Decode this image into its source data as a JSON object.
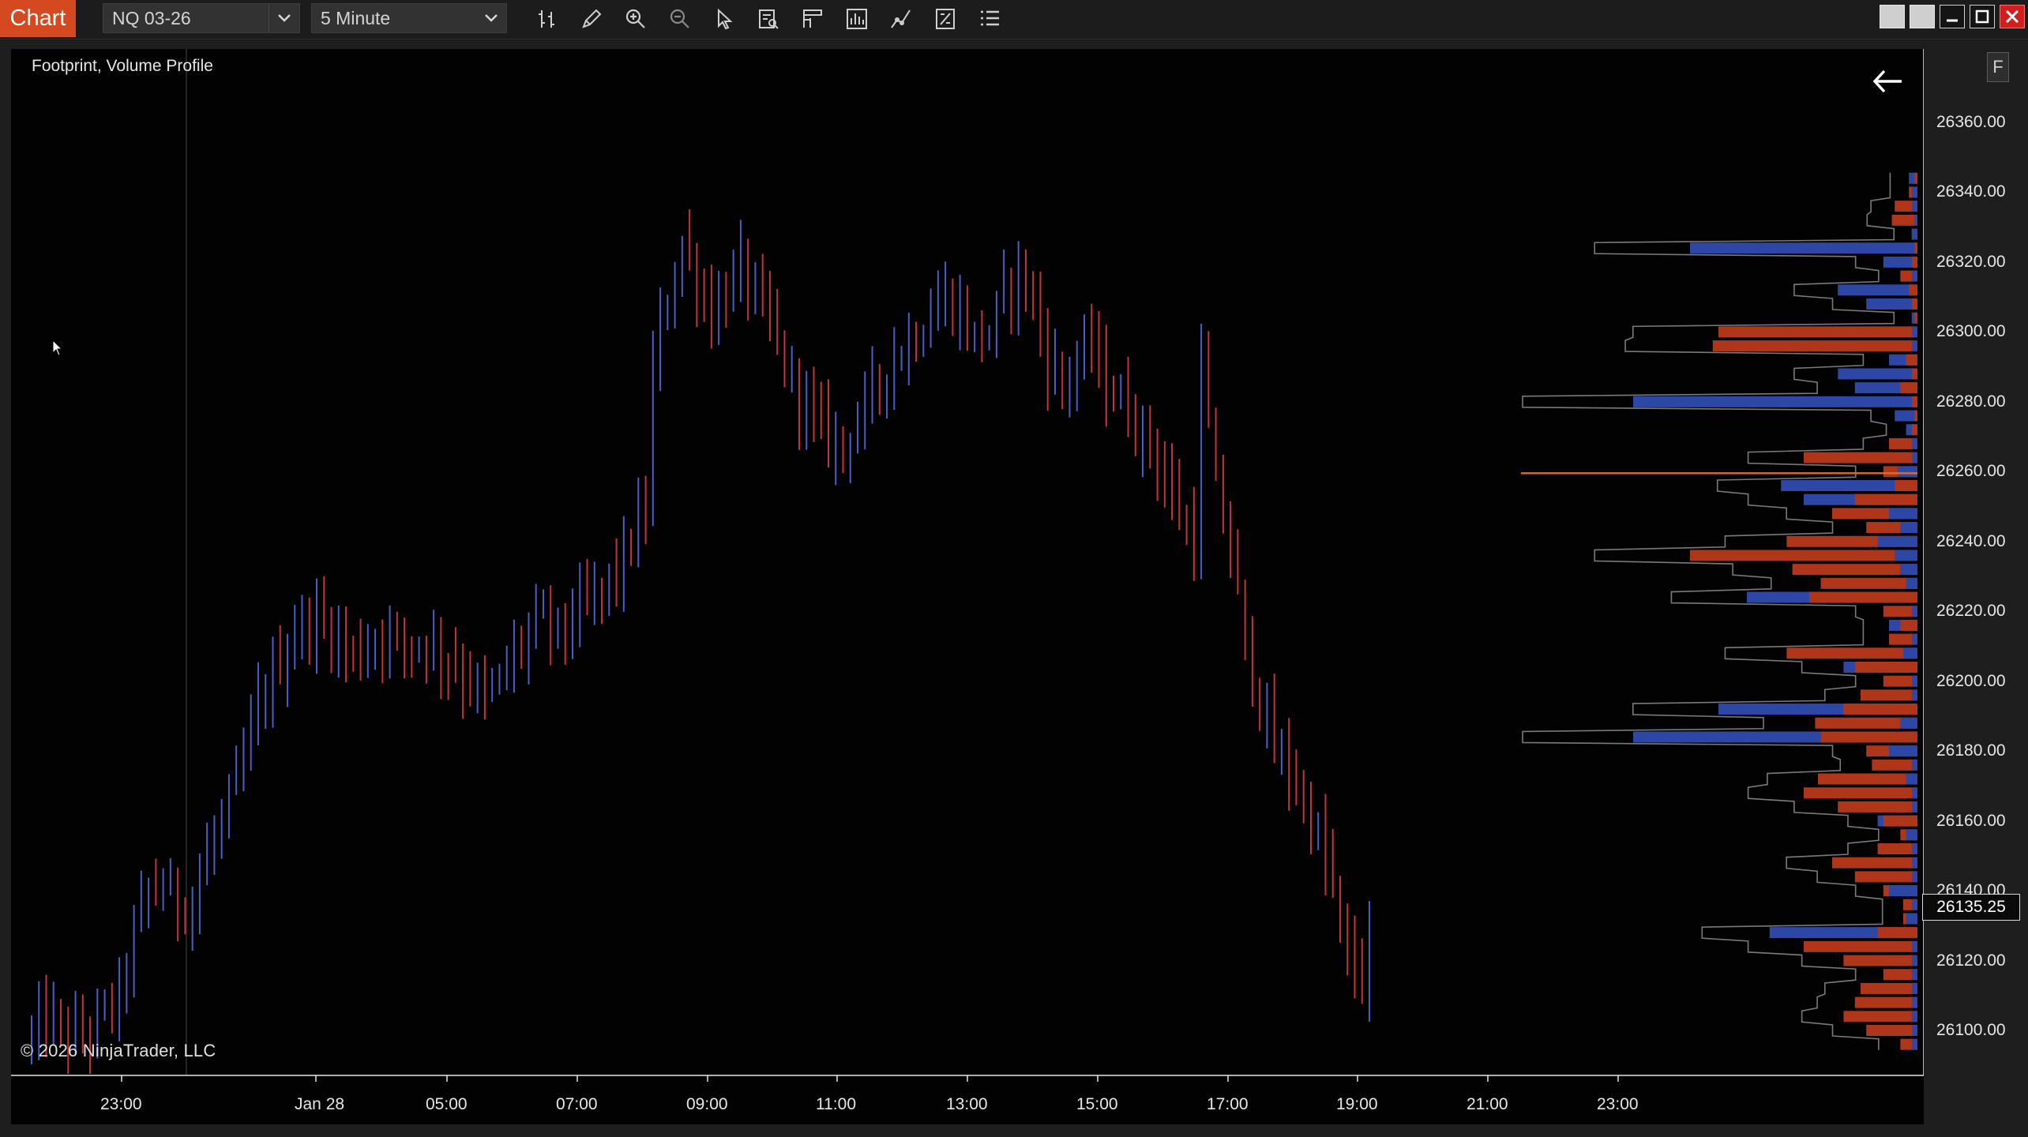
{
  "toolbar": {
    "chart_tab": "Chart",
    "instrument": "NQ 03-26",
    "timeframe": "5 Minute",
    "icons": [
      "bar-type-icon",
      "draw-pencil-icon",
      "zoom-in-icon",
      "zoom-out-icon",
      "pointer-icon",
      "data-box-icon",
      "chart-trader-icon",
      "indicators-icon",
      "strategies-icon",
      "properties-icon",
      "list-icon"
    ]
  },
  "window_controls": [
    "tile-icon",
    "tile-icon",
    "minimize-icon",
    "maximize-icon",
    "close-icon"
  ],
  "chart": {
    "label": "Footprint, Volume Profile",
    "copyright": "© 2026 NinjaTrader, LLC",
    "panel_button": "F",
    "last_price": "26135.25"
  },
  "chart_data": {
    "type": "ohlc-bars",
    "instrument": "NQ 03-26",
    "interval": "5 Minute",
    "price_axis": {
      "ticks": [
        "26360.00",
        "26340.00",
        "26320.00",
        "26300.00",
        "26280.00",
        "26260.00",
        "26240.00",
        "26220.00",
        "26200.00",
        "26180.00",
        "26160.00",
        "26140.00",
        "26120.00",
        "26100.00"
      ],
      "ylim": [
        26088,
        26376
      ]
    },
    "time_axis": {
      "ticks": [
        "23:00",
        "Jan 28",
        "05:00",
        "07:00",
        "09:00",
        "11:00",
        "13:00",
        "15:00",
        "17:00",
        "19:00",
        "21:00",
        "23:00"
      ]
    },
    "colors": {
      "up": "#4a5ec8",
      "down": "#c8323c",
      "profile_ask": "#b0361a",
      "profile_bid": "#2d47a6",
      "poc": "#d7702a"
    },
    "price_path": [
      [
        0,
        26098
      ],
      [
        2,
        26104
      ],
      [
        4,
        26100
      ],
      [
        6,
        26098
      ],
      [
        8,
        26100
      ],
      [
        10,
        26105
      ],
      [
        12,
        26110
      ],
      [
        14,
        26128
      ],
      [
        16,
        26140
      ],
      [
        18,
        26142
      ],
      [
        20,
        26136
      ],
      [
        22,
        26138
      ],
      [
        24,
        26150
      ],
      [
        26,
        26160
      ],
      [
        28,
        26170
      ],
      [
        30,
        26185
      ],
      [
        32,
        26198
      ],
      [
        34,
        26206
      ],
      [
        36,
        26214
      ],
      [
        38,
        26218
      ],
      [
        40,
        26216
      ],
      [
        42,
        26212
      ],
      [
        44,
        26208
      ],
      [
        46,
        26210
      ],
      [
        48,
        26214
      ],
      [
        50,
        26212
      ],
      [
        52,
        26210
      ],
      [
        54,
        26212
      ],
      [
        56,
        26208
      ],
      [
        58,
        26205
      ],
      [
        60,
        26200
      ],
      [
        62,
        26195
      ],
      [
        64,
        26200
      ],
      [
        66,
        26208
      ],
      [
        68,
        26214
      ],
      [
        70,
        26218
      ],
      [
        72,
        26214
      ],
      [
        74,
        26218
      ],
      [
        76,
        26222
      ],
      [
        78,
        26226
      ],
      [
        80,
        26232
      ],
      [
        82,
        26240
      ],
      [
        84,
        26250
      ],
      [
        85,
        26290
      ],
      [
        87,
        26310
      ],
      [
        89,
        26325
      ],
      [
        91,
        26315
      ],
      [
        93,
        26305
      ],
      [
        95,
        26312
      ],
      [
        97,
        26318
      ],
      [
        99,
        26310
      ],
      [
        101,
        26302
      ],
      [
        103,
        26290
      ],
      [
        105,
        26282
      ],
      [
        107,
        26275
      ],
      [
        109,
        26270
      ],
      [
        111,
        26268
      ],
      [
        113,
        26275
      ],
      [
        115,
        26282
      ],
      [
        117,
        26290
      ],
      [
        119,
        26295
      ],
      [
        121,
        26300
      ],
      [
        123,
        26305
      ],
      [
        125,
        26310
      ],
      [
        127,
        26305
      ],
      [
        129,
        26298
      ],
      [
        131,
        26300
      ],
      [
        133,
        26310
      ],
      [
        135,
        26318
      ],
      [
        137,
        26308
      ],
      [
        139,
        26292
      ],
      [
        141,
        26285
      ],
      [
        143,
        26292
      ],
      [
        145,
        26296
      ],
      [
        147,
        26285
      ],
      [
        149,
        26280
      ],
      [
        151,
        26274
      ],
      [
        153,
        26268
      ],
      [
        155,
        26258
      ],
      [
        157,
        26248
      ],
      [
        159,
        26240
      ],
      [
        160,
        26290
      ],
      [
        162,
        26255
      ],
      [
        164,
        26238
      ],
      [
        166,
        26210
      ],
      [
        168,
        26195
      ],
      [
        170,
        26180
      ],
      [
        172,
        26175
      ],
      [
        174,
        26165
      ],
      [
        176,
        26155
      ],
      [
        178,
        26140
      ],
      [
        180,
        26120
      ],
      [
        182,
        26115
      ],
      [
        183,
        26125
      ]
    ],
    "volume_profile": {
      "price_levels_top_to_bottom": [
        26344,
        26340,
        26336,
        26332,
        26328,
        26324,
        26320,
        26316,
        26312,
        26308,
        26304,
        26300,
        26296,
        26292,
        26288,
        26284,
        26280,
        26276,
        26272,
        26268,
        26264,
        26260,
        26256,
        26252,
        26248,
        26244,
        26240,
        26236,
        26232,
        26228,
        26224,
        26220,
        26216,
        26212,
        26208,
        26204,
        26200,
        26196,
        26192,
        26188,
        26184,
        26180,
        26176,
        26172,
        26168,
        26164,
        26160,
        26156,
        26152,
        26148,
        26144,
        26140,
        26136,
        26132,
        26128,
        26124,
        26120,
        26116,
        26112,
        26108,
        26104,
        26100,
        26096
      ],
      "ask_volume_rel": [
        0.01,
        0.03,
        0.08,
        0.09,
        0.02,
        0.01,
        0.02,
        0.06,
        0.03,
        0.02,
        0.01,
        0.7,
        0.72,
        0.04,
        0.02,
        0.06,
        0.02,
        0.01,
        0.02,
        0.1,
        0.4,
        0.12,
        0.08,
        0.22,
        0.3,
        0.18,
        0.46,
        0.8,
        0.44,
        0.34,
        0.38,
        0.12,
        0.06,
        0.1,
        0.46,
        0.22,
        0.12,
        0.2,
        0.26,
        0.36,
        0.34,
        0.18,
        0.16,
        0.35,
        0.4,
        0.28,
        0.12,
        0.06,
        0.14,
        0.3,
        0.22,
        0.12,
        0.05,
        0.05,
        0.14,
        0.4,
        0.26,
        0.12,
        0.2,
        0.22,
        0.26,
        0.18,
        0.06
      ],
      "bid_volume_rel": [
        0.03,
        0.02,
        0.02,
        0.01,
        0.02,
        0.8,
        0.12,
        0.02,
        0.28,
        0.18,
        0.02,
        0.02,
        0.02,
        0.1,
        0.28,
        0.22,
        1.0,
        0.08,
        0.04,
        0.02,
        0.02,
        0.07,
        0.48,
        0.4,
        0.1,
        0.06,
        0.14,
        0.08,
        0.06,
        0.04,
        0.6,
        0.02,
        0.1,
        0.02,
        0.05,
        0.26,
        0.02,
        0.02,
        0.7,
        0.06,
        1.0,
        0.1,
        0.02,
        0.04,
        0.02,
        0.02,
        0.14,
        0.04,
        0.02,
        0.02,
        0.02,
        0.1,
        0.02,
        0.04,
        0.52,
        0.02,
        0.02,
        0.02,
        0.02,
        0.02,
        0.02,
        0.02,
        0.02
      ],
      "poc_price": 26260
    }
  }
}
